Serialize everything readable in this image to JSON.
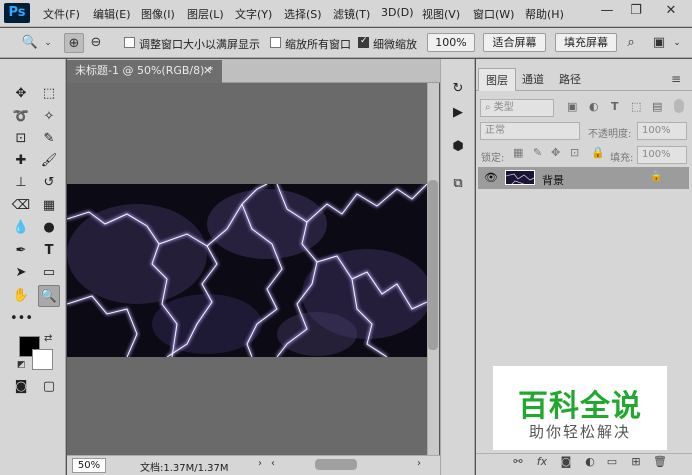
{
  "app": {
    "logo": "Ps"
  },
  "menu": [
    "文件(F)",
    "编辑(E)",
    "图像(I)",
    "图层(L)",
    "文字(Y)",
    "选择(S)",
    "滤镜(T)",
    "3D(D)",
    "视图(V)",
    "窗口(W)",
    "帮助(H)"
  ],
  "options": {
    "resize_windows": "调整窗口大小以满屏显示",
    "zoom_all_windows": "缩放所有窗口",
    "scrubby_zoom": "细微缩放",
    "zoom_100": "100%",
    "fit_screen": "适合屏幕",
    "fill_screen": "填充屏幕"
  },
  "document": {
    "tab_title": "未标题-1 @ 50%(RGB/8) *",
    "zoom_level": "50%",
    "doc_info": "文档:1.37M/1.37M"
  },
  "layers_panel": {
    "tabs": [
      "图层",
      "通道",
      "路径"
    ],
    "filter_kind": "类型",
    "blend_mode": "正常",
    "opacity_label": "不透明度:",
    "opacity_value": "100%",
    "lock_label": "锁定:",
    "fill_label": "填充:",
    "fill_value": "100%",
    "layer_name": "背景"
  },
  "watermark": {
    "title": "百科全说",
    "subtitle": "助你轻松解决"
  },
  "colors": {
    "accent": "#31a8ff",
    "watermark_green": "#22a82e",
    "canvas_bg": "#6a6a6a",
    "artwork_purple": "#2a1f44"
  }
}
